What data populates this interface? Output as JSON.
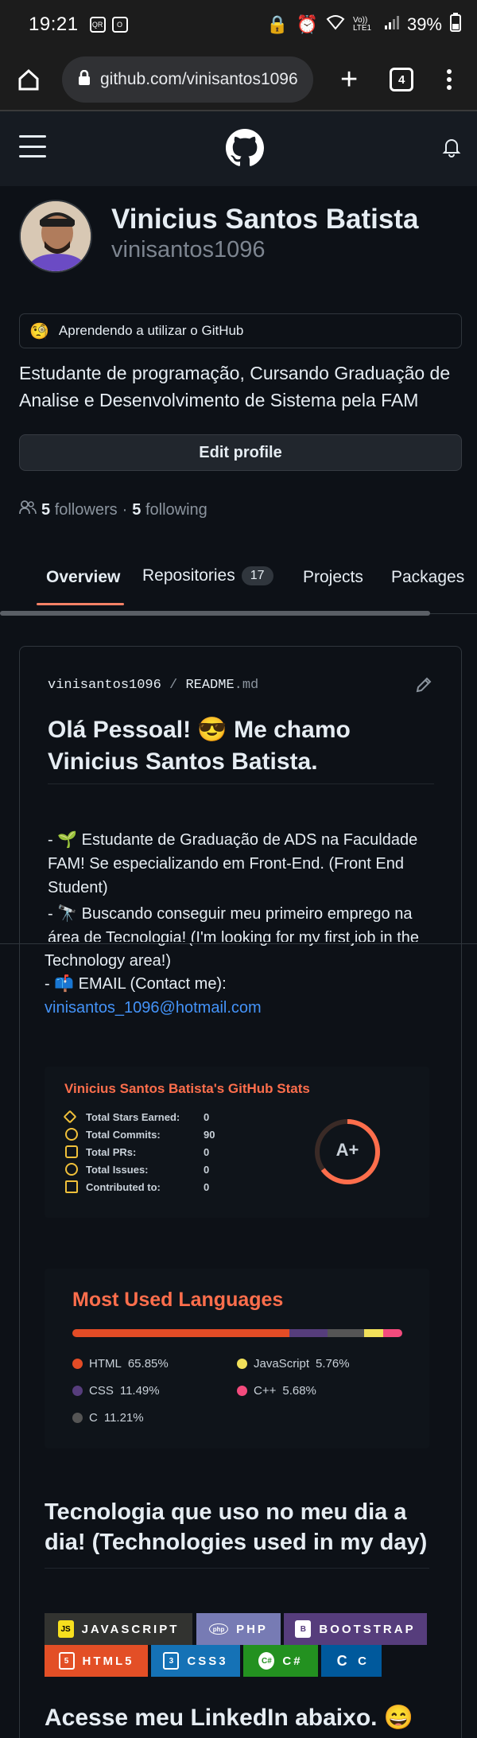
{
  "status_bar": {
    "time": "19:21",
    "icons_left": [
      "QR",
      "O"
    ],
    "network": "Vo)) LTE1",
    "battery": "39%"
  },
  "browser": {
    "url": "github.com/vinisantos1096",
    "tab_count": "4"
  },
  "profile": {
    "name": "Vinicius Santos Batista",
    "username": "vinisantos1096",
    "status_emoji": "🧐",
    "status_text": "Aprendendo a utilizar o GitHub",
    "bio": "Estudante de programação, Cursando Graduação de Analise e Desenvolvimento de Sistema pela FAM",
    "edit_profile_label": "Edit profile",
    "followers_count": "5",
    "followers_label": "followers",
    "separator": "·",
    "following_count": "5",
    "following_label": "following"
  },
  "tabs": [
    {
      "label": "Overview"
    },
    {
      "label": "Repositories",
      "count": "17"
    },
    {
      "label": "Projects"
    },
    {
      "label": "Packages"
    }
  ],
  "readme": {
    "path_user": "vinisantos1096",
    "path_sep": "/",
    "path_file": "README",
    "path_ext": ".md",
    "heading": "Olá Pessoal! 😎 Me chamo Vinicius Santos Batista.",
    "line1": "- 🌱 Estudante de Graduação de ADS na Faculdade FAM! Se especializando em Front-End. (Front End Student)",
    "line2_part1": "- 🔭 Buscando conseguir meu primeiro emprego na",
    "line2_part2": "área de Tecnologia! (I'm looking for my first job in the",
    "line2_part3": "Technology area!)",
    "email_label": "- 📫 EMAIL (Contact me):",
    "email": "vinisantos_1096@hotmail.com",
    "tech_heading": "Tecnologia que uso no meu dia a dia! (Technologies used in my day)",
    "linkedin_heading": "Acesse meu LinkedIn abaixo. 😄"
  },
  "stats_card": {
    "title": "Vinicius Santos Batista's GitHub Stats",
    "rows": [
      {
        "label": "Total Stars Earned:",
        "value": "0"
      },
      {
        "label": "Total Commits:",
        "value": "90"
      },
      {
        "label": "Total PRs:",
        "value": "0"
      },
      {
        "label": "Total Issues:",
        "value": "0"
      },
      {
        "label": "Contributed to:",
        "value": "0"
      }
    ],
    "grade": "A+",
    "title_color": "#fe6e4c",
    "icon_color": "#f0c03a"
  },
  "languages_card": {
    "title": "Most Used Languages",
    "languages": [
      {
        "name": "HTML",
        "percent": 65.85,
        "label": "65.85%",
        "color": "#e34c26"
      },
      {
        "name": "CSS",
        "percent": 11.49,
        "label": "11.49%",
        "color": "#563d7c"
      },
      {
        "name": "C",
        "percent": 11.21,
        "label": "11.21%",
        "color": "#555555"
      },
      {
        "name": "JavaScript",
        "percent": 5.76,
        "label": "5.76%",
        "color": "#f1e05a"
      },
      {
        "name": "C++",
        "percent": 5.68,
        "label": "5.68%",
        "color": "#f34b7d"
      }
    ]
  },
  "badges": [
    {
      "label": "JAVASCRIPT",
      "bg": "#323330",
      "icon": "JS",
      "icon_bg": "#f7df1e",
      "icon_fg": "#000000"
    },
    {
      "label": "PHP",
      "bg": "#777bb4",
      "icon": "php",
      "icon_bg": "#777bb4",
      "icon_fg": "#ffffff"
    },
    {
      "label": "BOOTSTRAP",
      "bg": "#563d7c",
      "icon": "B",
      "icon_bg": "#ffffff",
      "icon_fg": "#563d7c"
    },
    {
      "label": "HTML5",
      "bg": "#e34f26",
      "icon": "5",
      "icon_bg": "#ffffff",
      "icon_fg": "#e34f26"
    },
    {
      "label": "CSS3",
      "bg": "#1572b6",
      "icon": "3",
      "icon_bg": "#ffffff",
      "icon_fg": "#1572b6"
    },
    {
      "label": "C#",
      "bg": "#239120",
      "icon": "C#",
      "icon_bg": "#ffffff",
      "icon_fg": "#239120"
    },
    {
      "label": "C",
      "bg": "#00599c",
      "icon": "C",
      "icon_bg": "#00599c",
      "icon_fg": "#ffffff"
    }
  ]
}
